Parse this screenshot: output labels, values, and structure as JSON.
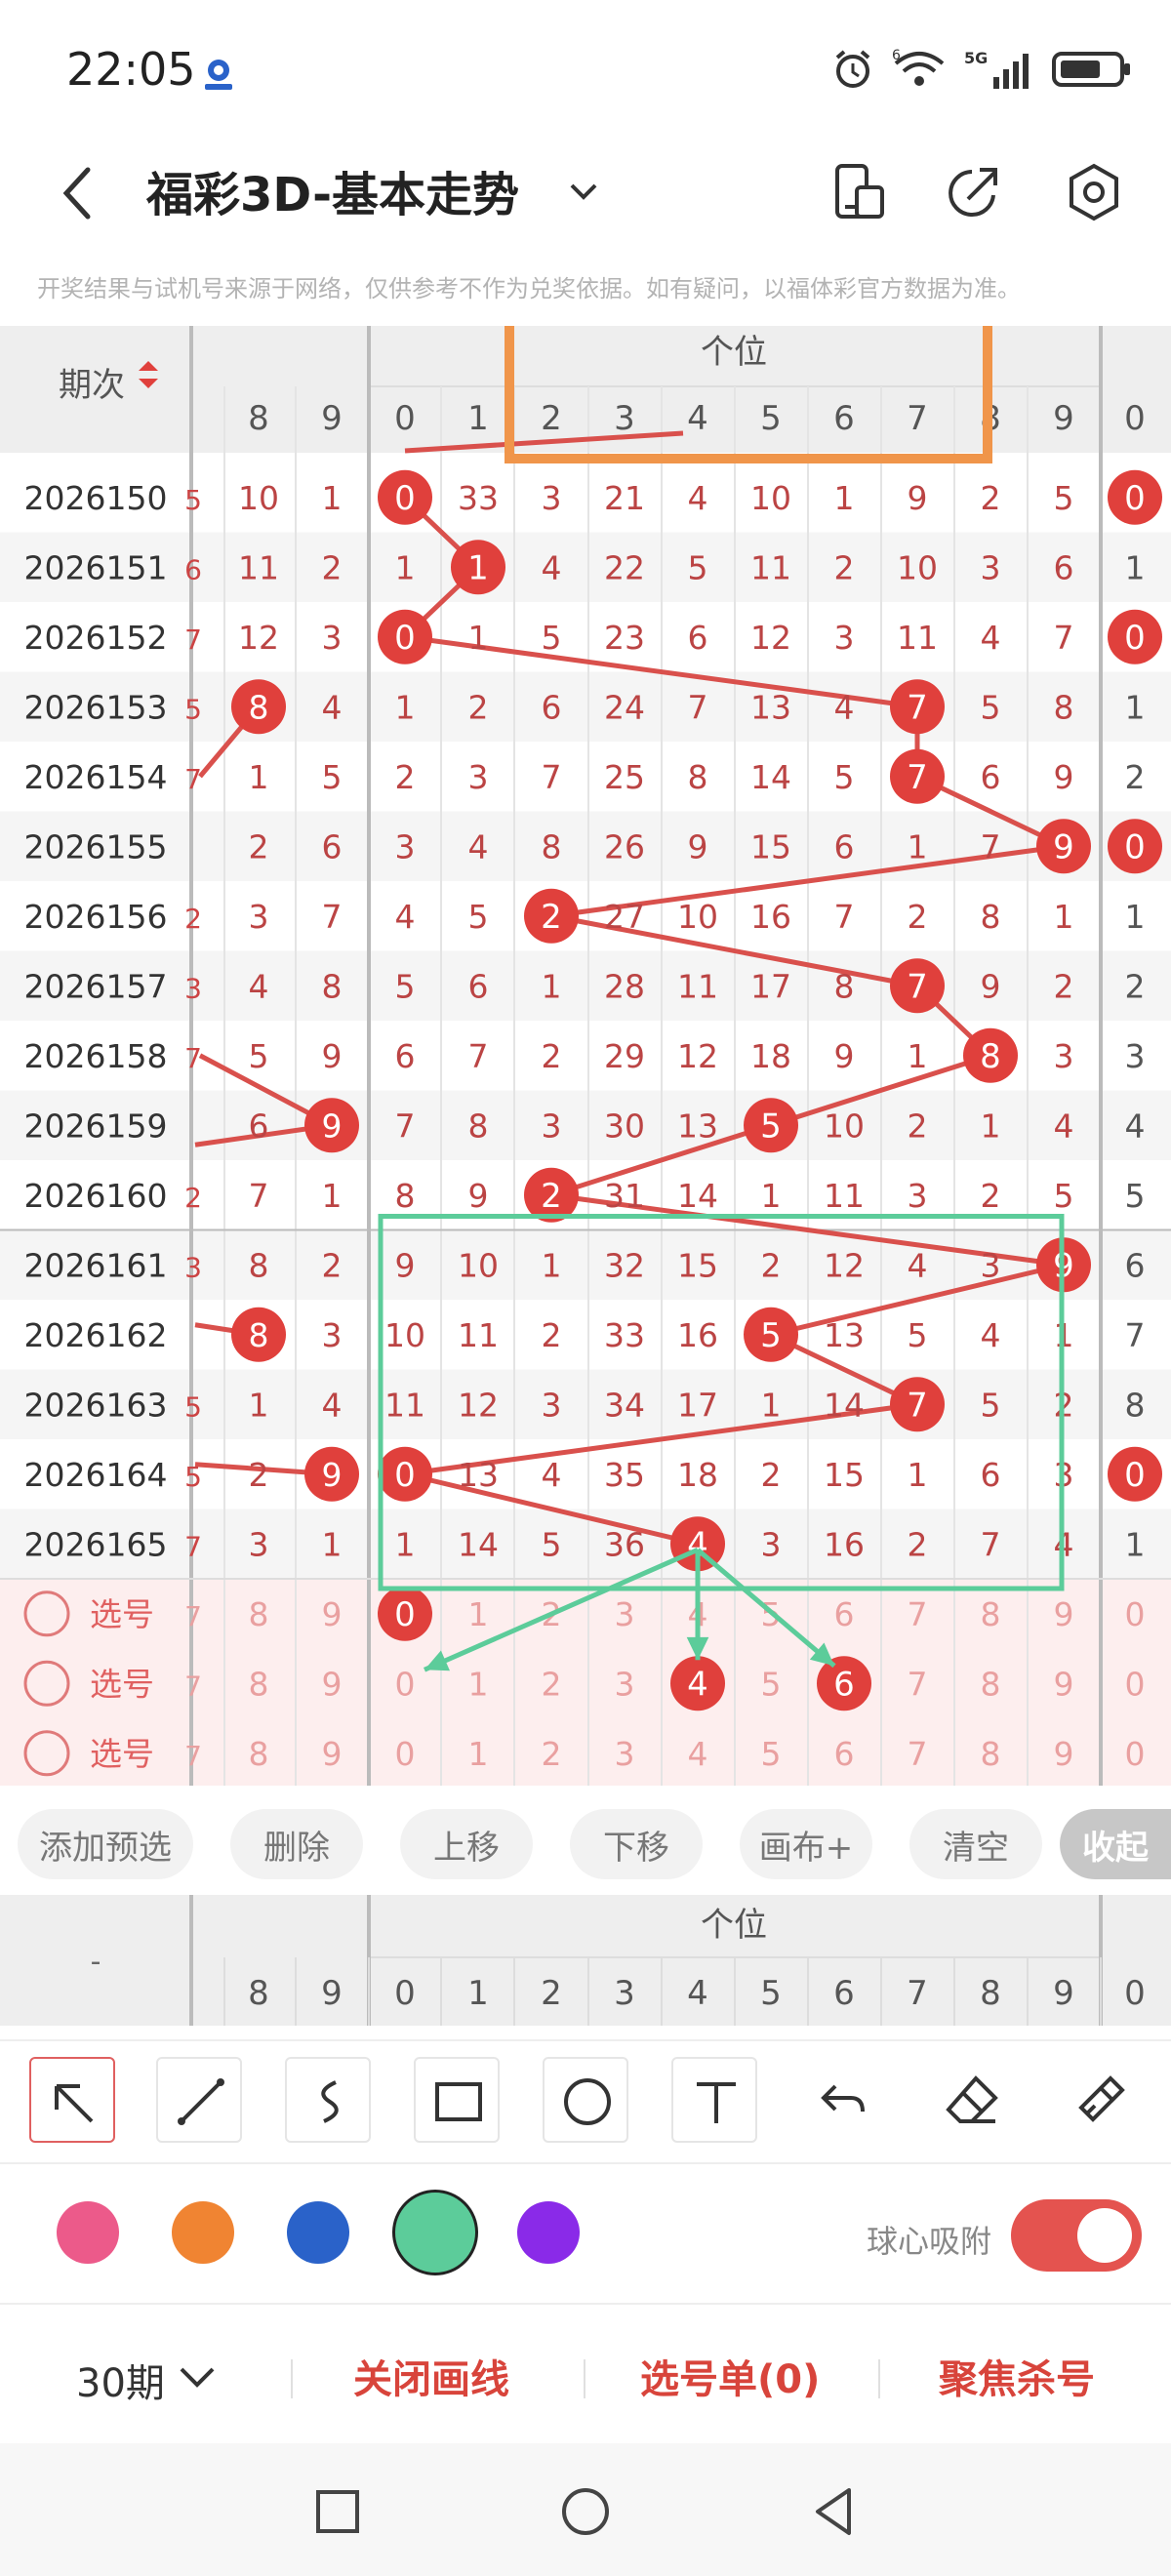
{
  "status": {
    "time": "22:05",
    "network": "5G",
    "wifi_badge": "6"
  },
  "header": {
    "title": "福彩3D-基本走势",
    "icons": [
      "back-icon",
      "chevron-down-icon",
      "phone-layout-icon",
      "share-icon",
      "settings-icon"
    ]
  },
  "notice": "开奖结果与试机号来源于网络，仅供参考不作为兑奖依据。如有疑问，以福体彩官方数据为准。",
  "table": {
    "period_header": "期次",
    "section_header": "个位",
    "left_cols": [
      "8",
      "9"
    ],
    "digit_cols": [
      "0",
      "1",
      "2",
      "3",
      "4",
      "5",
      "6",
      "7",
      "8",
      "9"
    ],
    "extra_col": "0",
    "rows": [
      {
        "period": "2026150",
        "lead": "5",
        "left": [
          "10",
          "1"
        ],
        "cells": [
          "0",
          "33",
          "3",
          "21",
          "4",
          "10",
          "1",
          "9",
          "2",
          "5"
        ],
        "hit": 0,
        "extra": "0",
        "extra_hit": true,
        "left_hit": null
      },
      {
        "period": "2026151",
        "lead": "6",
        "left": [
          "11",
          "2"
        ],
        "cells": [
          "1",
          "1",
          "4",
          "22",
          "5",
          "11",
          "2",
          "10",
          "3",
          "6"
        ],
        "hit": 1,
        "extra": "1",
        "extra_hit": false,
        "left_hit": null
      },
      {
        "period": "2026152",
        "lead": "7",
        "left": [
          "12",
          "3"
        ],
        "cells": [
          "0",
          "1",
          "5",
          "23",
          "6",
          "12",
          "3",
          "11",
          "4",
          "7"
        ],
        "hit": 0,
        "extra": "0",
        "extra_hit": true,
        "left_hit": null
      },
      {
        "period": "2026153",
        "lead": "5",
        "left": [
          "8",
          "4"
        ],
        "cells": [
          "1",
          "2",
          "6",
          "24",
          "7",
          "13",
          "4",
          "7",
          "5",
          "8"
        ],
        "hit": 7,
        "extra": "1",
        "extra_hit": false,
        "left_hit": 0
      },
      {
        "period": "2026154",
        "lead": "7",
        "left": [
          "1",
          "5"
        ],
        "cells": [
          "2",
          "3",
          "7",
          "25",
          "8",
          "14",
          "5",
          "7",
          "6",
          "9"
        ],
        "hit": 7,
        "extra": "2",
        "extra_hit": false,
        "left_hit": null
      },
      {
        "period": "2026155",
        "lead": "",
        "left": [
          "2",
          "6"
        ],
        "cells": [
          "3",
          "4",
          "8",
          "26",
          "9",
          "15",
          "6",
          "1",
          "7",
          "9"
        ],
        "hit": 9,
        "extra": "0",
        "extra_hit": true,
        "left_hit": null
      },
      {
        "period": "2026156",
        "lead": "2",
        "left": [
          "3",
          "7"
        ],
        "cells": [
          "4",
          "5",
          "2",
          "27",
          "10",
          "16",
          "7",
          "2",
          "8",
          "1"
        ],
        "hit": 2,
        "extra": "1",
        "extra_hit": false,
        "left_hit": null
      },
      {
        "period": "2026157",
        "lead": "3",
        "left": [
          "4",
          "8"
        ],
        "cells": [
          "5",
          "6",
          "1",
          "28",
          "11",
          "17",
          "8",
          "7",
          "9",
          "2"
        ],
        "hit": 7,
        "extra": "2",
        "extra_hit": false,
        "left_hit": null
      },
      {
        "period": "2026158",
        "lead": "7",
        "left": [
          "5",
          "9"
        ],
        "cells": [
          "6",
          "7",
          "2",
          "29",
          "12",
          "18",
          "9",
          "1",
          "8",
          "3"
        ],
        "hit": 8,
        "extra": "3",
        "extra_hit": false,
        "left_hit": null
      },
      {
        "period": "2026159",
        "lead": "",
        "left": [
          "6",
          "9"
        ],
        "cells": [
          "7",
          "8",
          "3",
          "30",
          "13",
          "5",
          "10",
          "2",
          "1",
          "4"
        ],
        "hit": 5,
        "extra": "4",
        "extra_hit": false,
        "left_hit": 1
      },
      {
        "period": "2026160",
        "lead": "2",
        "left": [
          "7",
          "1"
        ],
        "cells": [
          "8",
          "9",
          "2",
          "31",
          "14",
          "1",
          "11",
          "3",
          "2",
          "5"
        ],
        "hit": 2,
        "extra": "5",
        "extra_hit": false,
        "left_hit": null
      },
      {
        "period": "2026161",
        "lead": "3",
        "left": [
          "8",
          "2"
        ],
        "cells": [
          "9",
          "10",
          "1",
          "32",
          "15",
          "2",
          "12",
          "4",
          "3",
          "9"
        ],
        "hit": 9,
        "extra": "6",
        "extra_hit": false,
        "left_hit": null
      },
      {
        "period": "2026162",
        "lead": "",
        "left": [
          "8",
          "3"
        ],
        "cells": [
          "10",
          "11",
          "2",
          "33",
          "16",
          "5",
          "13",
          "5",
          "4",
          "1"
        ],
        "hit": 5,
        "extra": "7",
        "extra_hit": false,
        "left_hit": 0
      },
      {
        "period": "2026163",
        "lead": "5",
        "left": [
          "1",
          "4"
        ],
        "cells": [
          "11",
          "12",
          "3",
          "34",
          "17",
          "1",
          "14",
          "7",
          "5",
          "2"
        ],
        "hit": 7,
        "extra": "8",
        "extra_hit": false,
        "left_hit": null
      },
      {
        "period": "2026164",
        "lead": "5",
        "left": [
          "2",
          "9"
        ],
        "cells": [
          "0",
          "13",
          "4",
          "35",
          "18",
          "2",
          "15",
          "1",
          "6",
          "3"
        ],
        "hit": 0,
        "extra": "0",
        "extra_hit": true,
        "left_hit": 1
      },
      {
        "period": "2026165",
        "lead": "7",
        "left": [
          "3",
          "1"
        ],
        "cells": [
          "1",
          "14",
          "5",
          "36",
          "4",
          "3",
          "16",
          "2",
          "7",
          "4"
        ],
        "hit": 4,
        "extra": "1",
        "extra_hit": false,
        "left_hit": null
      }
    ],
    "select_rows": [
      {
        "label": "选号",
        "picked": 0
      },
      {
        "label": "选号",
        "picked": 4,
        "picked_b": 6
      },
      {
        "label": "选号",
        "picked": null
      }
    ],
    "select_row_left": [
      "8",
      "9"
    ],
    "select_row_lead": "7",
    "second_row_pick_b_label": "6"
  },
  "chips": [
    "添加预选",
    "删除",
    "上移",
    "下移",
    "画布+",
    "清空",
    "收起"
  ],
  "footer_header": {
    "dash": "-",
    "section_header": "个位"
  },
  "tools": [
    "arrow-tool-icon",
    "line-tool-icon",
    "curve-tool-icon",
    "rect-tool-icon",
    "circle-tool-icon",
    "text-tool-icon",
    "undo-icon",
    "eraser-icon",
    "brush-clear-icon"
  ],
  "colors": {
    "swatches": [
      "#ec5a8a",
      "#f08432",
      "#2a62c9",
      "#5ccc9a",
      "#8a2ae8"
    ],
    "selected": "#5ccc9a",
    "hit_ball": "#e0403c",
    "trend_line": "#d9504c",
    "annotation_orange": "#f0954a",
    "annotation_green": "#5ccc9a",
    "select_bg": "#fdeeee"
  },
  "snap": {
    "label": "球心吸附",
    "on": true
  },
  "bottom": {
    "period": "30期",
    "close_lines": "关闭画线",
    "pick_list": "选号单(0)",
    "focus_kill": "聚焦杀号"
  },
  "navbar": [
    "recent-apps-icon",
    "home-icon",
    "back-nav-icon"
  ]
}
